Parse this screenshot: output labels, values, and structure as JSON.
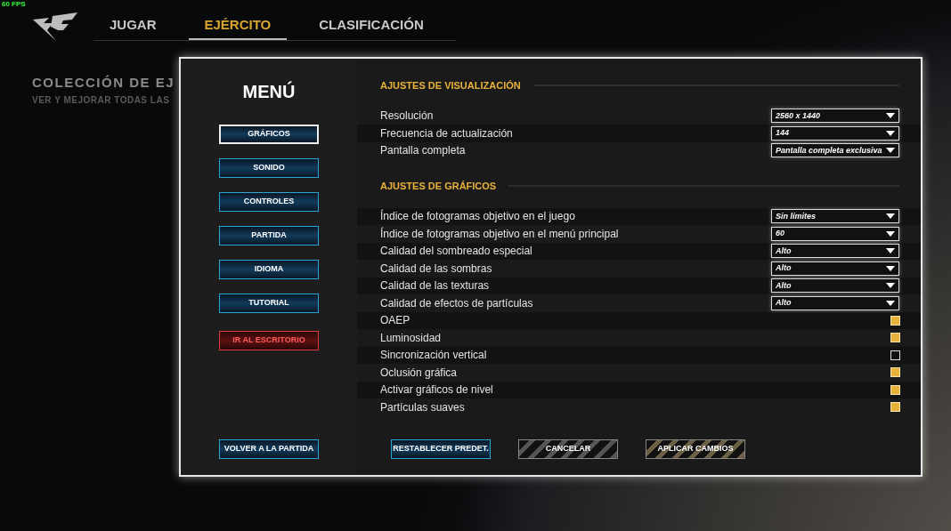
{
  "fps": "60 FPS",
  "nav": [
    {
      "label": "JUGAR",
      "selected": false
    },
    {
      "label": "EJÉRCITO",
      "selected": true
    },
    {
      "label": "CLASIFICACIÓN",
      "selected": false
    }
  ],
  "page": {
    "title": "COLECCIÓN DE EJ",
    "subtitle": "VER Y MEJORAR TODAS LAS"
  },
  "menu": {
    "title": "MENÚ",
    "items": [
      {
        "label": "GRÁFICOS",
        "kind": "normal",
        "selected": true
      },
      {
        "label": "SONIDO",
        "kind": "normal",
        "selected": false
      },
      {
        "label": "CONTROLES",
        "kind": "normal",
        "selected": false
      },
      {
        "label": "PARTIDA",
        "kind": "normal",
        "selected": false
      },
      {
        "label": "IDIOMA",
        "kind": "normal",
        "selected": false
      },
      {
        "label": "TUTORIAL",
        "kind": "normal",
        "selected": false
      },
      {
        "label": "IR AL ESCRITORIO",
        "kind": "danger",
        "selected": false
      }
    ],
    "back": "VOLVER A LA PARTIDA"
  },
  "sections": [
    {
      "title": "AJUSTES DE VISUALIZACIÓN",
      "rows": [
        {
          "kind": "dropdown",
          "label": "Resolución",
          "value": "2560 x 1440"
        },
        {
          "kind": "dropdown",
          "label": "Frecuencia de actualización",
          "value": "144"
        },
        {
          "kind": "dropdown",
          "label": "Pantalla completa",
          "value": "Pantalla completa exclusiva"
        }
      ]
    },
    {
      "title": "AJUSTES DE GRÁFICOS",
      "rows": [
        {
          "kind": "dropdown",
          "label": "Índice de fotogramas objetivo en el juego",
          "value": "Sin límites"
        },
        {
          "kind": "dropdown",
          "label": "Índice de fotogramas objetivo en el menú principal",
          "value": "60"
        },
        {
          "kind": "dropdown",
          "label": "Calidad del sombreado especial",
          "value": "Alto"
        },
        {
          "kind": "dropdown",
          "label": "Calidad de las sombras",
          "value": "Alto"
        },
        {
          "kind": "dropdown",
          "label": "Calidad de las texturas",
          "value": "Alto"
        },
        {
          "kind": "dropdown",
          "label": "Calidad de efectos de partículas",
          "value": "Alto"
        },
        {
          "kind": "checkbox",
          "label": "OAEP",
          "checked": true
        },
        {
          "kind": "checkbox",
          "label": "Luminosidad",
          "checked": true
        },
        {
          "kind": "checkbox",
          "label": "Sincronización vertical",
          "checked": false
        },
        {
          "kind": "checkbox",
          "label": "Oclusión gráfica",
          "checked": true
        },
        {
          "kind": "checkbox",
          "label": "Activar gráficos de nivel",
          "checked": true
        },
        {
          "kind": "checkbox",
          "label": "Partículas suaves",
          "checked": true
        }
      ]
    }
  ],
  "actions": [
    {
      "label": "RESTABLECER PREDET.",
      "kind": "blue"
    },
    {
      "label": "CANCELAR",
      "kind": "striped"
    },
    {
      "label": "APLICAR CAMBIOS",
      "kind": "gold"
    }
  ]
}
